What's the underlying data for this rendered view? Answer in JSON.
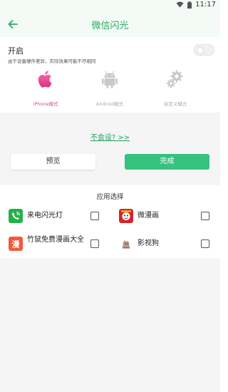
{
  "status_bar": {
    "time": "11:17"
  },
  "header": {
    "title": "微信闪光"
  },
  "toggle": {
    "label": "开启",
    "description": "由于设备硬件差异，实际效果可能不尽相同",
    "enabled": false
  },
  "modes": [
    {
      "label": "iPhone模式",
      "icon": "apple-icon",
      "active": true
    },
    {
      "label": "Android模式",
      "icon": "android-icon",
      "active": false
    },
    {
      "label": "自定义模式",
      "icon": "gear-icon",
      "active": false
    }
  ],
  "help_link": "不会设? >>",
  "buttons": {
    "preview": "预览",
    "done": "完成"
  },
  "app_select": {
    "title": "应用选择",
    "apps": [
      {
        "name": "来电闪光灯",
        "icon": "phone-flash-icon",
        "checked": false
      },
      {
        "name": "微漫画",
        "icon": "manga-icon",
        "checked": false
      },
      {
        "name": "竹鼠免费漫画大全",
        "icon": "comic-icon",
        "checked": false
      },
      {
        "name": "影视狗",
        "icon": "video-dog-icon",
        "checked": false
      }
    ]
  },
  "colors": {
    "accent": "#2aa866",
    "button_done": "#37c27f",
    "active_mode": "#e0468a",
    "background_gray": "#f5f5f5"
  }
}
